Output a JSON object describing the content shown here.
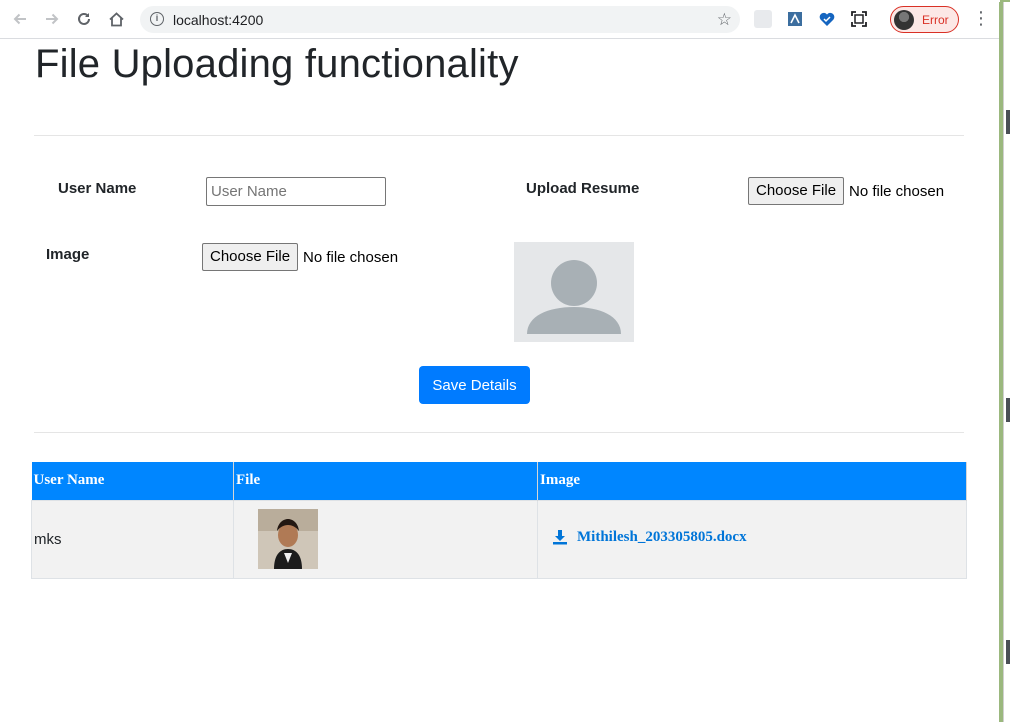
{
  "browser": {
    "url": "localhost:4200",
    "profile_status": "Error"
  },
  "page": {
    "title": "File Uploading functionality"
  },
  "form": {
    "username_label": "User Name",
    "username_placeholder": "User Name",
    "username_value": "",
    "resume_label": "Upload Resume",
    "resume_button": "Choose File",
    "resume_status": "No file chosen",
    "image_label": "Image",
    "image_button": "Choose File",
    "image_status": "No file chosen",
    "save_button": "Save Details"
  },
  "table": {
    "headers": [
      "User Name",
      "File",
      "Image"
    ],
    "rows": [
      {
        "user_name": "mks",
        "file_link": "Mithilesh_203305805.docx"
      }
    ]
  }
}
